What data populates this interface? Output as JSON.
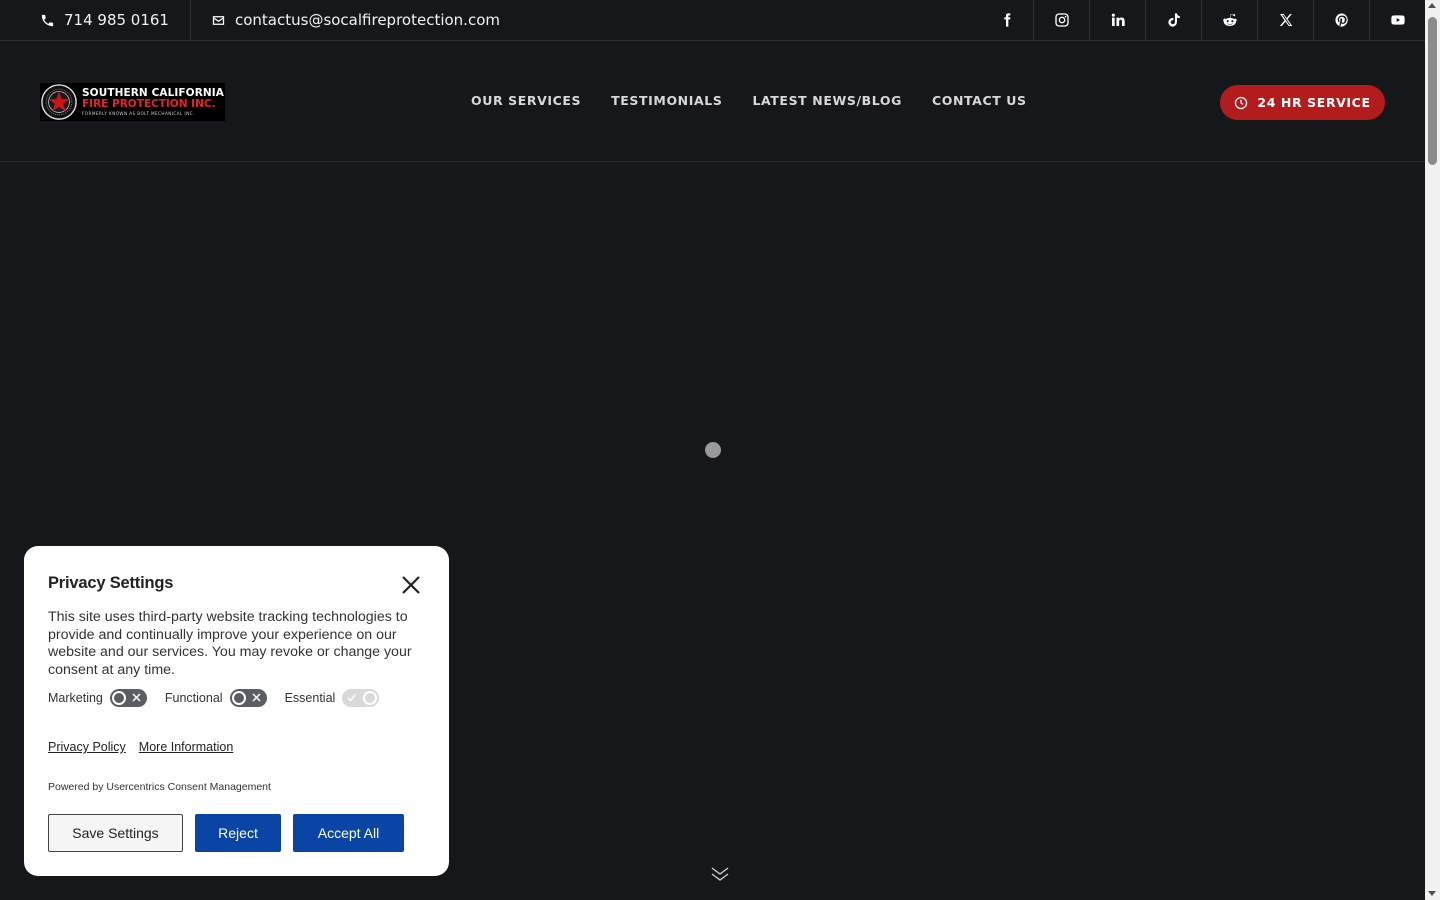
{
  "topbar": {
    "phone": "714 985 0161",
    "phone_icon": "phone-icon",
    "email": "contactus@socalfireprotection.com",
    "email_icon": "envelope-icon",
    "socials": [
      "facebook-icon",
      "instagram-icon",
      "linkedin-icon",
      "tiktok-icon",
      "reddit-icon",
      "x-icon",
      "pinterest-icon",
      "youtube-icon"
    ]
  },
  "header": {
    "logo": {
      "line1": "SOUTHERN CALIFORNIA",
      "line2": "FIRE PROTECTION INC.",
      "line3": "FORMERLY KNOWN AS BOLT MECHANICAL INC."
    },
    "nav": [
      "OUR SERVICES",
      "TESTIMONIALS",
      "LATEST NEWS/BLOG",
      "CONTACT US"
    ],
    "cta_label": "24 HR SERVICE"
  },
  "privacy": {
    "title": "Privacy Settings",
    "description": "This site uses third-party website tracking technologies to provide and continually improve your experience on our website and our services. You may revoke or change your consent at any time.",
    "toggles": [
      {
        "label": "Marketing",
        "enabled": false
      },
      {
        "label": "Functional",
        "enabled": false
      },
      {
        "label": "Essential",
        "enabled": true
      }
    ],
    "links": [
      "Privacy Policy",
      "More Information"
    ],
    "powered_by": "Powered by Usercentrics Consent Management",
    "buttons": {
      "save": "Save Settings",
      "reject": "Reject",
      "accept": "Accept All"
    }
  },
  "colors": {
    "background": "#16171a",
    "cta": "#b31c1c",
    "primary_button": "#0a45a6"
  }
}
